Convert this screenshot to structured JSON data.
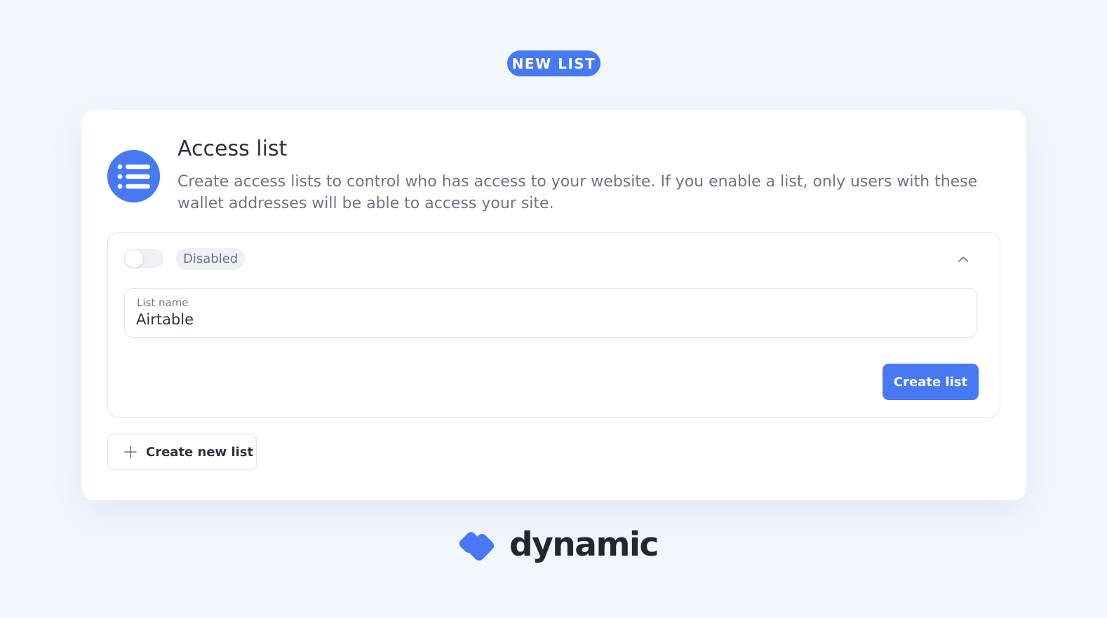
{
  "badge": {
    "label": "NEW LIST"
  },
  "card": {
    "title": "Access list",
    "description": "Create access lists to control who has access to your website. If you enable a list, only users with these wallet addresses will be able to access your site.",
    "header_icon": "list-icon"
  },
  "list_panel": {
    "toggle": {
      "enabled": false
    },
    "status_label": "Disabled",
    "collapse_icon": "chevron-up-icon",
    "name_field": {
      "label": "List name",
      "value": "Airtable"
    },
    "submit_label": "Create list"
  },
  "create_new": {
    "label": "Create new list",
    "icon": "plus-icon"
  },
  "brand": {
    "name": "dynamic",
    "logo_icon": "dynamic-logo-icon"
  },
  "colors": {
    "accent": "#4779f5",
    "background": "#f2f6fd",
    "text_primary": "#2e3240",
    "text_secondary": "#6e7487",
    "border": "#e3e7ee"
  }
}
